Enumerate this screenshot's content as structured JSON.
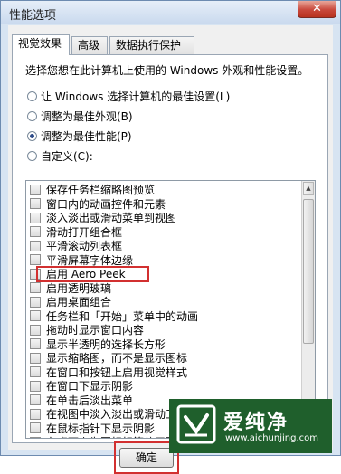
{
  "window": {
    "title": "性能选项",
    "close_label": "✕"
  },
  "tabs": [
    {
      "label": "视觉效果",
      "active": true
    },
    {
      "label": "高级",
      "active": false
    },
    {
      "label": "数据执行保护",
      "active": false
    }
  ],
  "description": "选择您想在此计算机上使用的 Windows 外观和性能设置。",
  "options": [
    {
      "label": "让 Windows 选择计算机的最佳设置(L)",
      "selected": false
    },
    {
      "label": "调整为最佳外观(B)",
      "selected": false
    },
    {
      "label": "调整为最佳性能(P)",
      "selected": true
    },
    {
      "label": "自定义(C):",
      "selected": false
    }
  ],
  "effects": [
    "保存任务栏缩略图预览",
    "窗口内的动画控件和元素",
    "淡入淡出或滑动菜单到视图",
    "滑动打开组合框",
    "平滑滚动列表框",
    "平滑屏幕字体边缘",
    "启用 Aero Peek",
    "启用透明玻璃",
    "启用桌面组合",
    "任务栏和「开始」菜单中的动画",
    "拖动时显示窗口内容",
    "显示半透明的选择长方形",
    "显示缩略图，而不是显示图标",
    "在窗口和按钮上启用视觉样式",
    "在窗口下显示阴影",
    "在单击后淡出菜单",
    "在视图中淡入淡出或滑动工具条提示",
    "在鼠标指针下显示阴影",
    "在桌面上为图标标签使用阴影"
  ],
  "ok_label": "确定",
  "watermark": {
    "text": "爱纯净",
    "url": "www.aichunjing.com"
  }
}
